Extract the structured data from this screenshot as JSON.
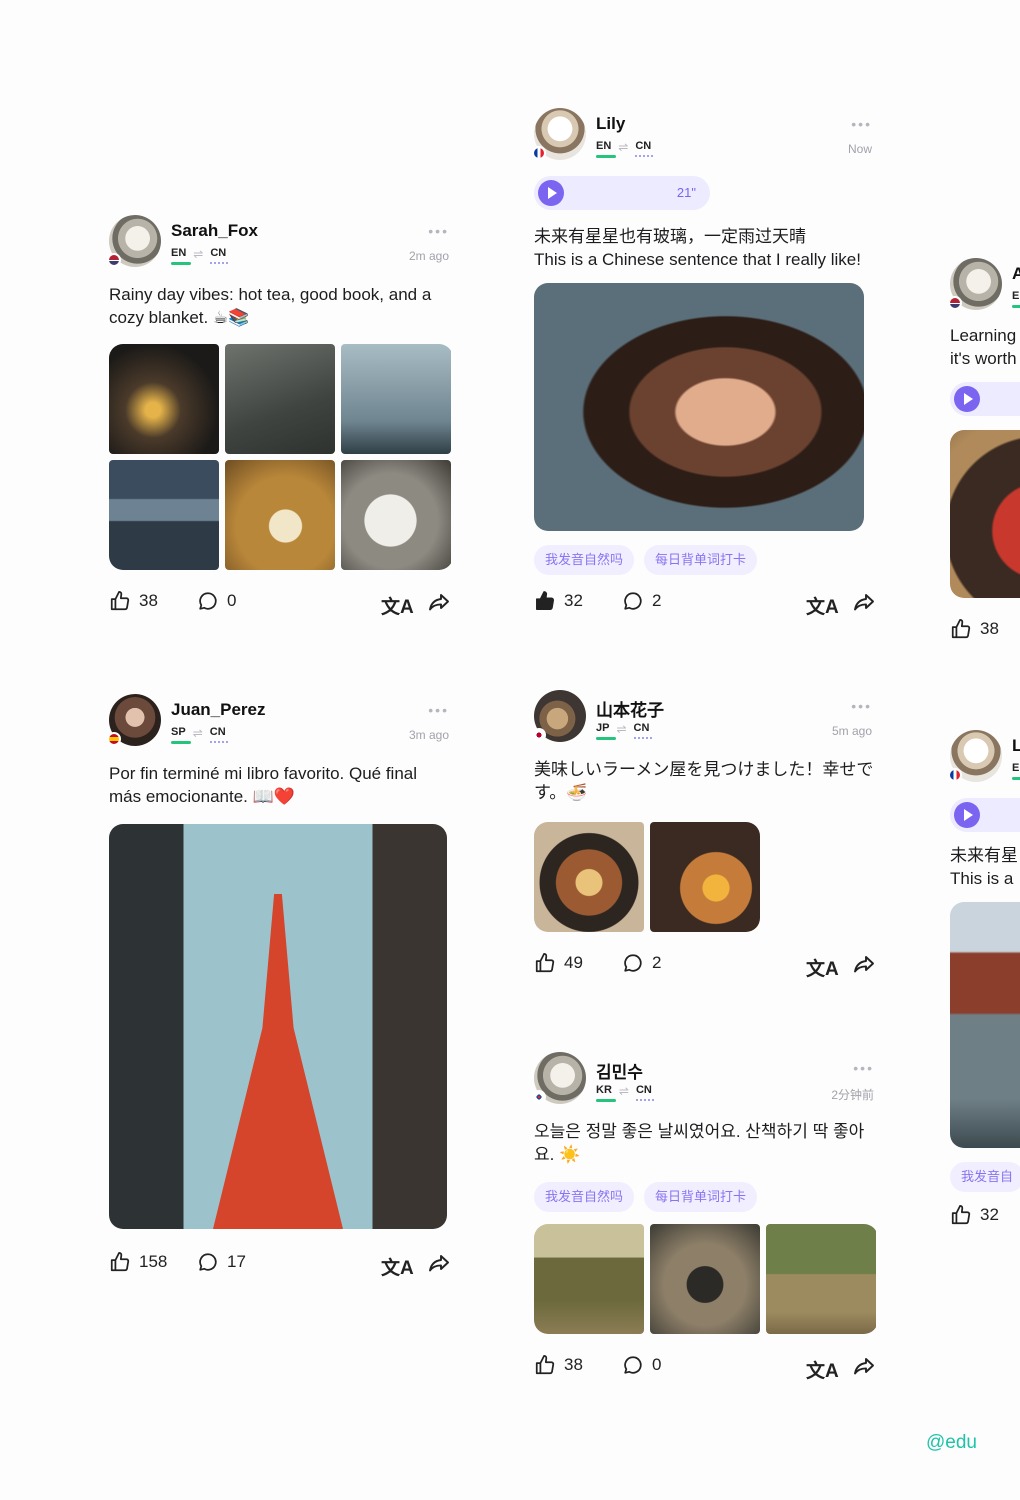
{
  "posts": [
    {
      "user": "Sarah_Fox",
      "from": "EN",
      "to": "CN",
      "time": "2m ago",
      "text": "Rainy day vibes: hot tea, good book, and a cozy blanket. ☕📚",
      "likes": "38",
      "comments": "0"
    },
    {
      "user": "Lily",
      "from": "EN",
      "to": "CN",
      "time": "Now",
      "voice": "21\"",
      "text": "未来有星星也有玻璃，一定雨过天晴",
      "text2": "This is a Chinese sentence that I really like!",
      "tags": [
        "我发音自然吗",
        "每日背单词打卡"
      ],
      "likes": "32",
      "comments": "2"
    },
    {
      "user": "Juan_Perez",
      "from": "SP",
      "to": "CN",
      "time": "3m ago",
      "text": "Por fin terminé mi libro favorito. Qué final más emocionante. 📖❤️",
      "likes": "158",
      "comments": "17"
    },
    {
      "user": "山本花子",
      "from": "JP",
      "to": "CN",
      "time": "5m ago",
      "text": "美味しいラーメン屋を見つけました！幸せです。🍜",
      "likes": "49",
      "comments": "2"
    },
    {
      "user": "김민수",
      "from": "KR",
      "to": "CN",
      "time": "2分钟前",
      "text": "오늘은 정말 좋은 날씨였어요. 산책하기 딱 좋아요. ☀️",
      "tags": [
        "我发音自然吗",
        "每日背单词打卡"
      ],
      "likes": "38",
      "comments": "0"
    },
    {
      "user": "A",
      "from": "EN",
      "text": "Learning",
      "text2": "it's worth",
      "likes": "38"
    },
    {
      "user": "L",
      "from": "EN",
      "text": "未来有星",
      "text2": "This is a",
      "tag": "我发音自",
      "likes": "32"
    }
  ],
  "icons": {
    "like": "thumbs-up-icon",
    "comment": "comment-icon",
    "translate": "translate-icon",
    "share": "share-icon",
    "more": "more-dots-icon",
    "play": "play-icon",
    "translate_glyph": "文A",
    "more_glyph": "•••",
    "swap_glyph": "⇌"
  },
  "colors": {
    "accent": "#7a64f0",
    "tag_bg": "#f1efff",
    "green": "#25c47d",
    "watermark": "#1fc3a8"
  },
  "watermark": "@edu"
}
